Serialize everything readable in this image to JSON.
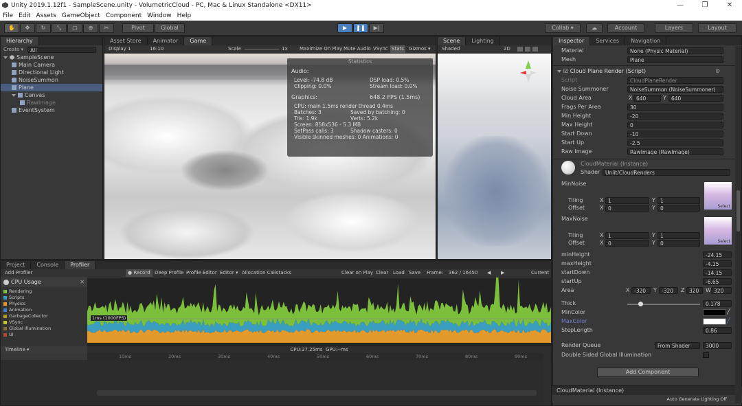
{
  "window": {
    "title": "Unity 2019.1.12f1 - SampleScene.unity - VolumetricCloud - PC, Mac & Linux Standalone <DX11>",
    "controls": [
      "—",
      "❐",
      "✕"
    ]
  },
  "menu": [
    "File",
    "Edit",
    "Assets",
    "GameObject",
    "Component",
    "Window",
    "Help"
  ],
  "toolbar": {
    "pivot": "Pivot",
    "global": "Global",
    "collab": "Collab ▾",
    "account": "Account",
    "layers": "Layers",
    "layout": "Layout"
  },
  "hierarchy": {
    "tab": "Hierarchy",
    "create": "Create ▾",
    "search_placeholder": "All",
    "items": [
      {
        "label": "SampleScene",
        "indent": 0,
        "selected": false,
        "dim": false
      },
      {
        "label": "Main Camera",
        "indent": 1,
        "selected": false,
        "dim": false
      },
      {
        "label": "Directional Light",
        "indent": 1,
        "selected": false,
        "dim": false
      },
      {
        "label": "NoiseSummon",
        "indent": 1,
        "selected": false,
        "dim": false
      },
      {
        "label": "Plane",
        "indent": 1,
        "selected": true,
        "dim": false
      },
      {
        "label": "Canvas",
        "indent": 1,
        "selected": false,
        "dim": false
      },
      {
        "label": "RawImage",
        "indent": 2,
        "selected": false,
        "dim": true
      },
      {
        "label": "EventSystem",
        "indent": 1,
        "selected": false,
        "dim": false
      }
    ]
  },
  "center_tabs": [
    "Asset Store",
    "Animator",
    "Game"
  ],
  "game_bar": {
    "display": "Display 1",
    "aspect": "16:10",
    "scale_label": "Scale",
    "scale_value": "1x",
    "maximize": "Maximize On Play",
    "mute": "Mute Audio",
    "vsync": "VSync",
    "stats": "Stats",
    "gizmos": "Gizmos ▾"
  },
  "stats": {
    "title": "Statistics",
    "audio_header": "Audio:",
    "level": "Level: -74.8 dB",
    "clipping": "Clipping: 0.0%",
    "dsp": "DSP load: 0.5%",
    "stream": "Stream load: 0.0%",
    "graphics_header": "Graphics:",
    "fps": "648.2 FPS (1.5ms)",
    "cpu": "CPU: main 1.5ms  render thread 0.4ms",
    "batches": "Batches: 3",
    "saved": "Saved by batching: 0",
    "tris": "Tris: 1.9k",
    "verts": "Verts: 5.2k",
    "screen": "Screen: 858x536 - 5.3 MB",
    "setpass": "SetPass calls: 3",
    "shadow": "Shadow casters: 0",
    "skinned": "Visible skinned meshes: 0  Animations: 0"
  },
  "scene_tabs": [
    "Scene",
    "Lighting"
  ],
  "scene_bar": {
    "shaded": "Shaded",
    "mode": "2D"
  },
  "inspector": {
    "tabs": [
      "Inspector",
      "Services",
      "Navigation"
    ],
    "material_label": "Material",
    "material_value": "None (Physic Material)",
    "mesh_label": "Mesh",
    "mesh_value": "Plane",
    "component_title": "Cloud Plane Render (Script)",
    "script_label": "Script",
    "script_value": "CloudPlaneRender",
    "noise_label": "Noise Summoner",
    "noise_value": "NoiseSummon (NoiseSummoner)",
    "area_label": "Cloud Area",
    "area_x": "640",
    "area_y": "640",
    "frags_label": "Frags Per Area",
    "frags_value": "30",
    "minh_label": "Min Height",
    "minh_value": "-20",
    "maxh_label": "Max Height",
    "maxh_value": "0",
    "sdown_label": "Start Down",
    "sdown_value": "-10",
    "sup_label": "Start Up",
    "sup_value": "-2.5",
    "raw_label": "Raw Image",
    "raw_value": "RawImage (RawImage)",
    "mat_title": "CloudMaterial (Instance)",
    "shader_label": "Shader",
    "shader_value": "Unlit/CloudRenders",
    "minnoise": "MinNoise",
    "maxnoise": "MaxNoise",
    "tiling": "Tiling",
    "offset": "Offset",
    "x": "X",
    "y": "Y",
    "z": "Z",
    "w": "W",
    "one": "1",
    "zero": "0",
    "select": "Select",
    "minheight_label": "minHeight",
    "minheight": "-24.15",
    "maxheight_label": "maxHeight",
    "maxheight": "-4.15",
    "startdown_label": "startDown",
    "startdown": "-14.15",
    "startup_label": "startUp",
    "startup": "-6.65",
    "area2_label": "Area",
    "area2_x": "-320",
    "area2_y": "-320",
    "area2_z": "320",
    "area2_w": "320",
    "thick_label": "Thick",
    "thick": "0.178",
    "thick_fraction": 0.18,
    "mincolor_label": "MinColor",
    "maxcolor_label": "MaxColor",
    "step_label": "StepLength",
    "step": "0.86",
    "rq_label": "Render Queue",
    "rq_mode": "From Shader",
    "rq_value": "3000",
    "dsgi": "Double Sided Global Illumination",
    "add_component": "Add Component",
    "footer": "CloudMaterial (Instance)",
    "autogen": "Auto Generate Lighting Off"
  },
  "bottom_tabs": [
    "Project",
    "Console",
    "Profiler"
  ],
  "profiler": {
    "add": "Add Profiler",
    "record": "Record",
    "deep": "Deep Profile",
    "editor": "Profile Editor",
    "editor_dd": "Editor ▾",
    "alloc": "Allocation Callstacks",
    "clear_play": "Clear on Play",
    "clear": "Clear",
    "load": "Load",
    "save": "Save",
    "frame_label": "Frame:",
    "frame_value": "362 / 16450",
    "current": "Current",
    "cpu_title": "CPU Usage",
    "legend": [
      {
        "name": "Rendering",
        "color": "#7cbf3a"
      },
      {
        "name": "Scripts",
        "color": "#3a9ec0"
      },
      {
        "name": "Physics",
        "color": "#e39a2b"
      },
      {
        "name": "Animation",
        "color": "#3c7fcf"
      },
      {
        "name": "GarbageCollector",
        "color": "#b09a1a"
      },
      {
        "name": "VSync",
        "color": "#c8c030"
      },
      {
        "name": "Global Illumination",
        "color": "#8a6a3a"
      },
      {
        "name": "UI",
        "color": "#b04a2a"
      }
    ],
    "fps_marker": "1ms (1000FPS)",
    "cpu_readout": "CPU:27.25ms",
    "gpu_readout": "GPU:--ms",
    "timeline": "Timeline ▾",
    "ruler": [
      "10ms",
      "20ms",
      "30ms",
      "40ms",
      "50ms",
      "60ms",
      "70ms",
      "80ms",
      "90ms"
    ]
  }
}
